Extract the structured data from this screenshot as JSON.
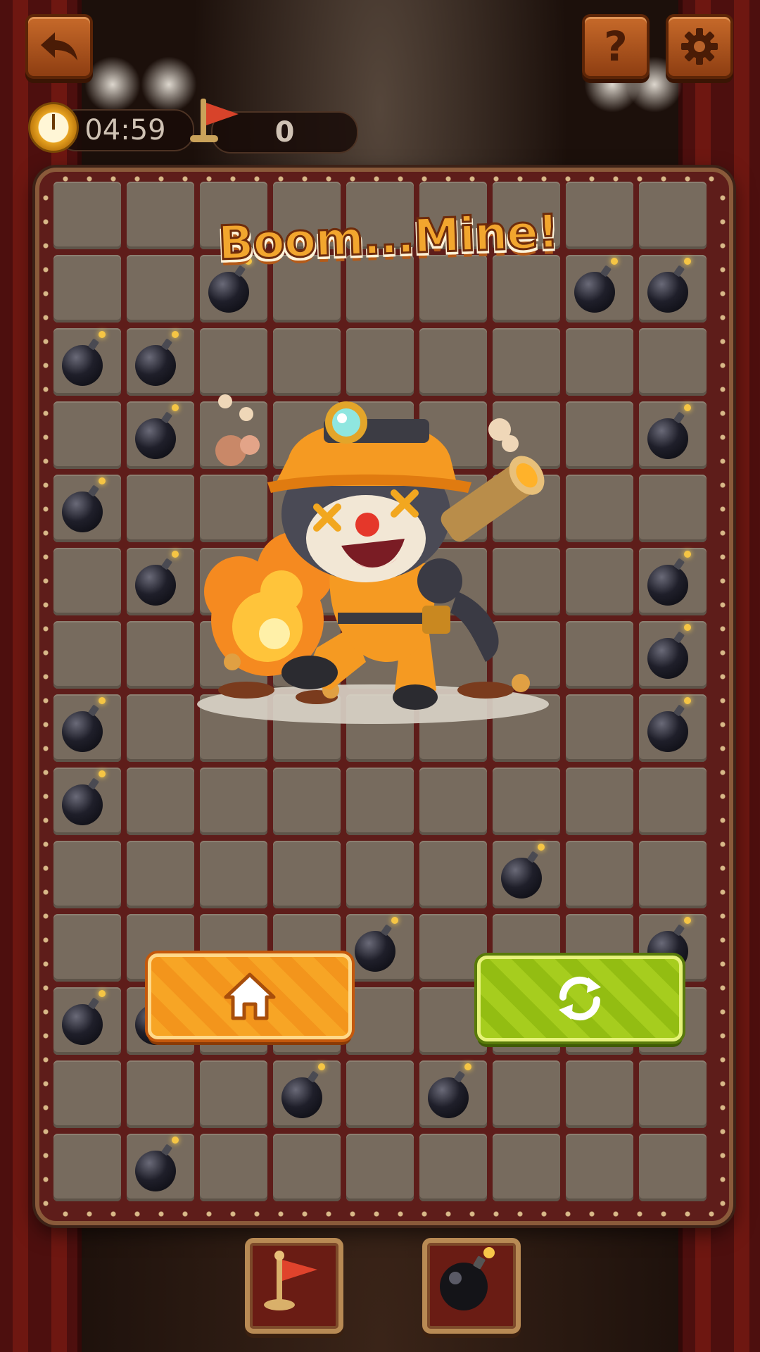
{
  "hud": {
    "timer": "04:59",
    "flags": "0"
  },
  "icons": {
    "back": "back-arrow-icon",
    "help": "question-mark-icon",
    "settings": "gear-icon",
    "timer": "alarm-clock-icon",
    "flags": "flag-icon",
    "home": "house-icon",
    "restart": "refresh-icon",
    "flag_tool": "flag-icon",
    "bomb_tool": "bomb-icon"
  },
  "game_over": {
    "title": "Boom...Mine!"
  },
  "board": {
    "rows": 14,
    "cols": 9,
    "mines": [
      [
        1,
        2
      ],
      [
        1,
        7
      ],
      [
        1,
        8
      ],
      [
        2,
        0
      ],
      [
        2,
        1
      ],
      [
        3,
        1
      ],
      [
        3,
        8
      ],
      [
        4,
        0
      ],
      [
        5,
        1
      ],
      [
        5,
        8
      ],
      [
        6,
        8
      ],
      [
        7,
        0
      ],
      [
        7,
        8
      ],
      [
        8,
        0
      ],
      [
        9,
        6
      ],
      [
        10,
        4
      ],
      [
        10,
        8
      ],
      [
        11,
        0
      ],
      [
        11,
        1
      ],
      [
        12,
        3
      ],
      [
        12,
        5
      ],
      [
        13,
        1
      ]
    ]
  },
  "colors": {
    "home_button": "#f7a525",
    "restart_button": "#a6cd1e",
    "title_text": "#f2a62e",
    "board_frame": "#5e1d1a",
    "cell": "#776b5e"
  }
}
